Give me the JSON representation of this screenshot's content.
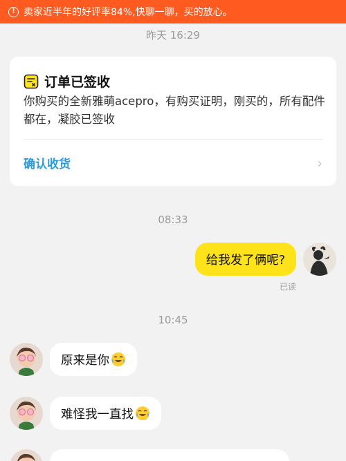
{
  "banner": {
    "icon": "warning-icon",
    "text": "卖家近半年的好评率84%,快聊一聊，买的放心。",
    "color": "#ff5a1f"
  },
  "timestamps": {
    "t1": "昨天 16:29",
    "t2": "08:33",
    "t3": "10:45"
  },
  "order_card": {
    "icon": "receipt-icon",
    "title": "订单已签收",
    "description": "你购买的全新雅萌acepro，有购买证明，刚买的，所有配件都在，凝胶已签收",
    "action_label": "确认收货",
    "action_color": "#2b9bdb"
  },
  "messages": {
    "mine": {
      "text": "给我发了俩呢?",
      "status": "已读",
      "bubble_color": "#ffe31a"
    },
    "theirs": [
      {
        "text": "原来是你",
        "emoji": "crying-laughing-emoji"
      },
      {
        "text": "难怪我一直找",
        "emoji": "crying-laughing-emoji"
      }
    ]
  }
}
